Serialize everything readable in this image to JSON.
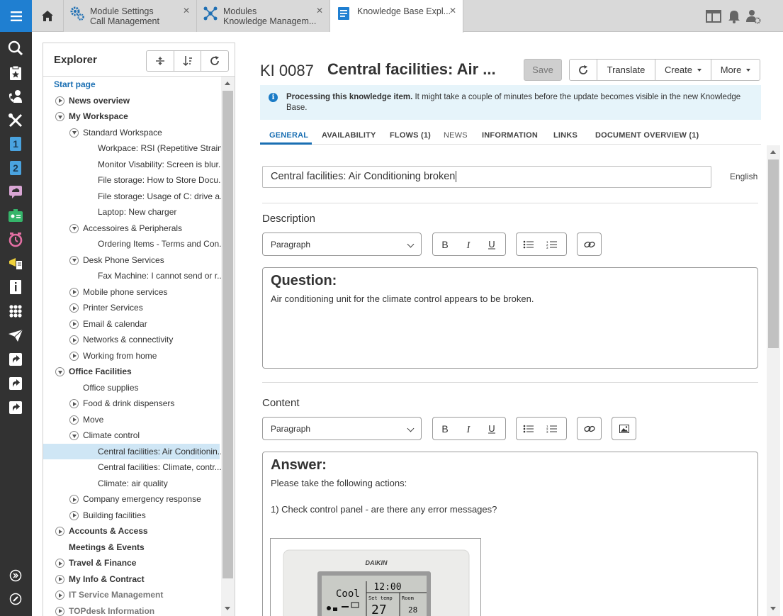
{
  "colors": {
    "accent": "#1f7fd1",
    "rail": "#323232",
    "selected_row": "#cfe6f5",
    "info_bg": "#e6f4fa"
  },
  "rail": {
    "icons": [
      "menu-icon",
      "search-icon",
      "star-clipboard-icon",
      "phone-person-icon",
      "tools-icon",
      "number-one-icon",
      "number-two-icon",
      "cloud-chat-icon",
      "id-card-icon",
      "alarm-clock-icon",
      "megaphone-icon",
      "info-book-icon",
      "modules-icon",
      "paper-plane-icon",
      "shortcut-icon",
      "shortcut-icon",
      "shortcut-icon",
      "expand-icon",
      "edit-icon"
    ]
  },
  "tabs": [
    {
      "line1": "Module Settings",
      "line2": "Call Management",
      "icon": "gears-icon"
    },
    {
      "line1": "Modules",
      "line2": "Knowledge Managem...",
      "icon": "modules-icon"
    },
    {
      "line1": "Knowledge Base Expl...",
      "line2": "",
      "icon": "knowledge-base-icon"
    }
  ],
  "tab_close": "✕",
  "explorer": {
    "title": "Explorer",
    "tree": [
      {
        "label": "Start page",
        "level": 0,
        "toggle": "none",
        "style": "blue"
      },
      {
        "label": "News overview",
        "level": 0,
        "toggle": "right",
        "style": "bold"
      },
      {
        "label": "My Workspace",
        "level": 0,
        "toggle": "down",
        "style": "bold"
      },
      {
        "label": "Standard Workspace",
        "level": 1,
        "toggle": "down",
        "style": ""
      },
      {
        "label": "Workpace: RSI (Repetitive Strain...",
        "level": 2,
        "toggle": "none",
        "style": ""
      },
      {
        "label": "Monitor Visability: Screen is blur...",
        "level": 2,
        "toggle": "none",
        "style": ""
      },
      {
        "label": "File storage: How to Store Docu...",
        "level": 2,
        "toggle": "none",
        "style": ""
      },
      {
        "label": "File storage: Usage of C: drive a...",
        "level": 2,
        "toggle": "none",
        "style": ""
      },
      {
        "label": "Laptop: New charger",
        "level": 2,
        "toggle": "none",
        "style": ""
      },
      {
        "label": "Accessoires & Peripherals",
        "level": 1,
        "toggle": "down",
        "style": ""
      },
      {
        "label": "Ordering Items - Terms and Con...",
        "level": 2,
        "toggle": "none",
        "style": ""
      },
      {
        "label": "Desk Phone Services",
        "level": 1,
        "toggle": "down",
        "style": ""
      },
      {
        "label": "Fax Machine: I cannot send or r...",
        "level": 2,
        "toggle": "none",
        "style": ""
      },
      {
        "label": "Mobile phone services",
        "level": 1,
        "toggle": "right",
        "style": ""
      },
      {
        "label": "Printer Services",
        "level": 1,
        "toggle": "right",
        "style": ""
      },
      {
        "label": "Email & calendar",
        "level": 1,
        "toggle": "right",
        "style": ""
      },
      {
        "label": "Networks & connectivity",
        "level": 1,
        "toggle": "right",
        "style": ""
      },
      {
        "label": "Working from home",
        "level": 1,
        "toggle": "right",
        "style": ""
      },
      {
        "label": "Office Facilities",
        "level": 0,
        "toggle": "down",
        "style": "bold"
      },
      {
        "label": "Office supplies",
        "level": 1,
        "toggle": "none",
        "style": ""
      },
      {
        "label": "Food & drink dispensers",
        "level": 1,
        "toggle": "right",
        "style": ""
      },
      {
        "label": "Move",
        "level": 1,
        "toggle": "right",
        "style": ""
      },
      {
        "label": "Climate control",
        "level": 1,
        "toggle": "down",
        "style": ""
      },
      {
        "label": "Central facilities: Air Conditionin...",
        "level": 2,
        "toggle": "none",
        "style": "",
        "selected": true
      },
      {
        "label": "Central facilities: Climate, contr...",
        "level": 2,
        "toggle": "none",
        "style": ""
      },
      {
        "label": "Climate: air quality",
        "level": 2,
        "toggle": "none",
        "style": ""
      },
      {
        "label": "Company emergency response",
        "level": 1,
        "toggle": "right",
        "style": ""
      },
      {
        "label": "Building facilities",
        "level": 1,
        "toggle": "right",
        "style": ""
      },
      {
        "label": "Accounts & Access",
        "level": 0,
        "toggle": "right",
        "style": "bold"
      },
      {
        "label": "Meetings & Events",
        "level": 0,
        "toggle": "none",
        "style": "bold"
      },
      {
        "label": "Travel & Finance",
        "level": 0,
        "toggle": "right",
        "style": "bold"
      },
      {
        "label": "My Info & Contract",
        "level": 0,
        "toggle": "right",
        "style": "bold"
      },
      {
        "label": "IT Service Management",
        "level": 0,
        "toggle": "right",
        "style": "muted"
      },
      {
        "label": "TOPdesk Information",
        "level": 0,
        "toggle": "right",
        "style": "muted"
      }
    ]
  },
  "item": {
    "id": "KI 0087",
    "title": "Central facilities: Air ...",
    "save_label": "Save",
    "buttons": {
      "translate": "Translate",
      "create": "Create",
      "more": "More"
    },
    "info_bold": "Processing this knowledge item.",
    "info_rest": " It might take a couple of minutes before the update becomes visible in the new Knowledge Base.",
    "tabs": [
      {
        "label": "GENERAL",
        "active": true,
        "light": false
      },
      {
        "label": "AVAILABILITY",
        "active": false,
        "light": false
      },
      {
        "label": "FLOWS (1)",
        "active": false,
        "light": false
      },
      {
        "label": "NEWS",
        "active": false,
        "light": true
      },
      {
        "label": "INFORMATION",
        "active": false,
        "light": false
      },
      {
        "label": "LINKS",
        "active": false,
        "light": false
      },
      {
        "label": "DOCUMENT OVERVIEW (1)",
        "active": false,
        "light": false
      }
    ],
    "title_value": "Central facilities: Air Conditioning broken",
    "language": "English",
    "description": {
      "label": "Description",
      "format": "Paragraph",
      "heading": "Question:",
      "text": "Air conditioning unit for the climate control appears to be broken."
    },
    "content": {
      "label": "Content",
      "format": "Paragraph",
      "heading": "Answer:",
      "line1": "Please take the following actions:",
      "line2": "1) Check control panel - are there any error messages?",
      "image_text": {
        "brand": "DAIKIN",
        "mode": "Cool",
        "time": "12:00",
        "set_temp_label": "Set temp",
        "room_label": "Room",
        "set_temp": "27",
        "room": "28"
      }
    }
  }
}
